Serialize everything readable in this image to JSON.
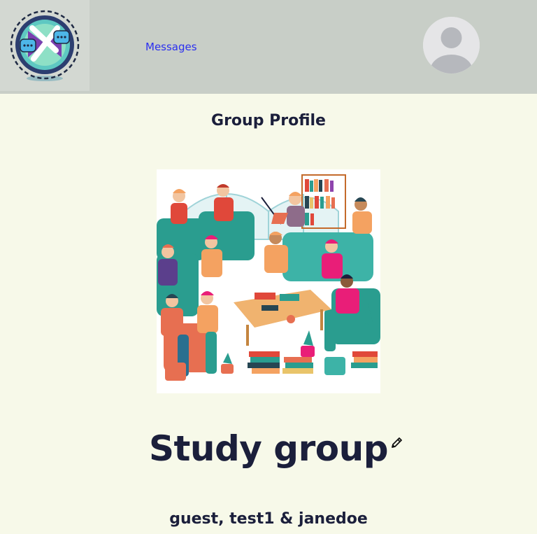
{
  "header": {
    "logo_icon": "chat-exchange-logo-icon",
    "nav": {
      "messages_label": "Messages"
    },
    "avatar_icon": "user-avatar-icon"
  },
  "main": {
    "page_title": "Group Profile",
    "group_image_icon": "group-illustration-image",
    "group_name": "Study group",
    "edit_icon": "pencil-icon",
    "members_line": "guest, test1 & janedoe"
  },
  "colors": {
    "topbar_bg": "#c8cec7",
    "page_bg": "#f7f9e9",
    "text_dark": "#1b1f3b",
    "link_blue": "#2b2ff0"
  }
}
